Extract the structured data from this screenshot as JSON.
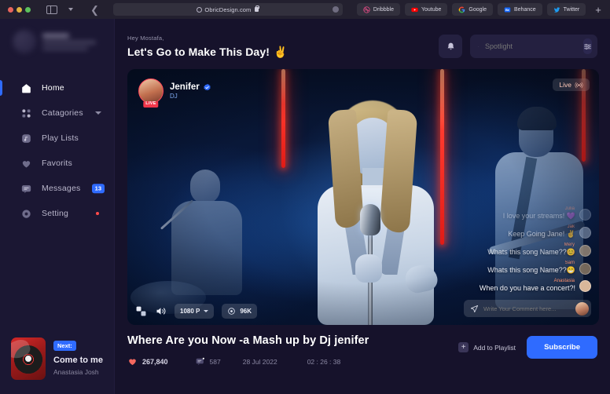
{
  "browser": {
    "url": "ObricDesign.com",
    "url_icon": "clock-icon",
    "lock_icon": "lock-icon",
    "back_icon": "back-chevron-icon",
    "sidebar_icon": "sidebar-toggle-icon",
    "new_tab_label": "+",
    "tabs": [
      {
        "label": "Dribbble",
        "icon": "dribbble-icon",
        "color": "#ea4c89"
      },
      {
        "label": "Youtube",
        "icon": "youtube-icon",
        "color": "#ff0000"
      },
      {
        "label": "Google",
        "icon": "google-icon",
        "color": "#4285f4"
      },
      {
        "label": "Behance",
        "icon": "behance-icon",
        "color": "#1769ff"
      },
      {
        "label": "Twitter",
        "icon": "twitter-icon",
        "color": "#1d9bf0"
      }
    ]
  },
  "sidebar": {
    "profile": {
      "name": "",
      "email": "",
      "blurred": true
    },
    "items": [
      {
        "label": "Home",
        "icon": "home-icon",
        "active": true
      },
      {
        "label": "Catagories",
        "icon": "grid-icon",
        "active": false,
        "chevron": true
      },
      {
        "label": "Play Lists",
        "icon": "playlist-icon",
        "active": false
      },
      {
        "label": "Favorits",
        "icon": "heart-icon",
        "active": false
      },
      {
        "label": "Messages",
        "icon": "message-icon",
        "active": false,
        "badge": "13"
      },
      {
        "label": "Setting",
        "icon": "gear-icon",
        "active": false,
        "dot": true
      }
    ],
    "next_up": {
      "badge": "Next:",
      "title": "Come to me",
      "artist": "Anastasia Josh"
    }
  },
  "header": {
    "greeting_small": "Hey Mostafa,",
    "greeting_big": "Let's Go to Make This Day!",
    "greeting_emoji": "✌️",
    "bell_icon": "bell-icon",
    "search_placeholder": "Spotlight",
    "search_value": "",
    "search_icon": "search-icon",
    "filter_icon": "sliders-icon"
  },
  "video": {
    "streamer": {
      "name": "Jenifer",
      "role": "DJ",
      "verified_icon": "verified-badge-icon",
      "live_badge": "LIVE"
    },
    "live_tag": {
      "label": "Live",
      "icon": "broadcast-icon"
    },
    "controls": {
      "fullscreen_icon": "fullscreen-icon",
      "volume_icon": "volume-icon",
      "quality": "1080 P",
      "quality_chevron": "chevron-down-icon",
      "viewers_icon": "eye-icon",
      "viewers": "96K"
    },
    "chat": [
      {
        "name": "Julia",
        "text": "I love your streams! 💜",
        "avatar": "#6a7fa0"
      },
      {
        "name": "Jak",
        "text": "Keep Going Jane! ✌️",
        "avatar": "#8796b0"
      },
      {
        "name": "Mery",
        "text": "Whats this song Name??😊",
        "avatar": "#9a8a78"
      },
      {
        "name": "Sam",
        "text": "Whats this song Name??😁",
        "avatar": "#7e6f5e"
      },
      {
        "name": "Anastasia",
        "text": "When do you have a concert?!",
        "avatar": "#d8b79a"
      }
    ],
    "comment_box": {
      "placeholder": "Write Your Comment here...",
      "send_icon": "send-icon",
      "avatar": "user-avatar"
    }
  },
  "details": {
    "title": "Where Are you Now -a Mash up by Dj jenifer",
    "likes_icon": "heart-icon",
    "likes": "267,840",
    "comments_icon": "comment-icon",
    "comments": "587",
    "date": "28 Jul 2022",
    "duration": "02 : 26 : 38",
    "add_to_playlist": "Add to Playlist",
    "add_icon": "plus-icon",
    "subscribe": "Subscribe"
  },
  "colors": {
    "accent": "#2f6bff",
    "bg": "#16122b",
    "sidebar_bg": "#1b1733",
    "live_red": "#f0374b"
  }
}
